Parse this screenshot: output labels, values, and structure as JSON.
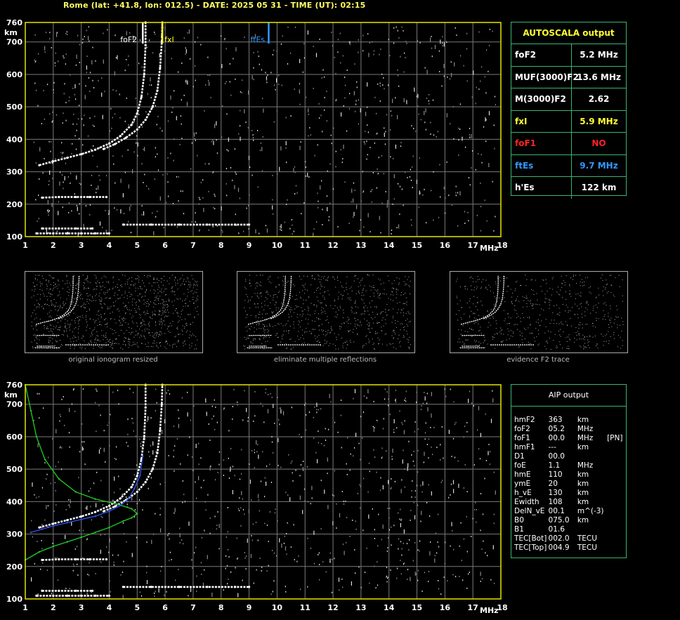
{
  "header": {
    "title": "Rome (lat: +41.8, lon: 012.5) - DATE: 2025 05 31 - TIME (UT): 02:15"
  },
  "colors": {
    "frame": "#e6e600",
    "grid": "#7a7a7a",
    "panel_border": "#3cb371",
    "trace": "#ffffff",
    "fxl": "#ffff33",
    "ftes": "#3399ff",
    "no": "#ff2222",
    "profile": "#22cc22",
    "fit": "#3355ff"
  },
  "autoscala": {
    "title": "AUTOSCALA output",
    "rows": [
      {
        "label": "foF2",
        "value": "5.2 MHz",
        "color": "#ffffff"
      },
      {
        "label": "MUF(3000)F2",
        "value": "13.6 MHz",
        "color": "#ffffff"
      },
      {
        "label": "M(3000)F2",
        "value": "2.62",
        "color": "#ffffff"
      },
      {
        "label": "fxI",
        "value": "5.9 MHz",
        "color": "#ffff33"
      },
      {
        "label": "foF1",
        "value": "NO",
        "color": "#ff2222"
      },
      {
        "label": "ftEs",
        "value": "9.7 MHz",
        "color": "#3399ff"
      },
      {
        "label": "h'Es",
        "value": "122    km",
        "color": "#ffffff"
      }
    ]
  },
  "aip": {
    "title": "AIP output",
    "rows": [
      [
        "hmF2",
        "363",
        "km",
        ""
      ],
      [
        "foF2",
        "05.2",
        "MHz",
        ""
      ],
      [
        "foF1",
        "00.0",
        "MHz",
        "[PN]"
      ],
      [
        "hmF1",
        "---",
        "km",
        ""
      ],
      [
        "D1",
        "00.0",
        "",
        ""
      ],
      [
        "foE",
        "1.1",
        "MHz",
        ""
      ],
      [
        "hmE",
        "110",
        "km",
        ""
      ],
      [
        "ymE",
        "20",
        "km",
        ""
      ],
      [
        "h_vE",
        "130",
        "km",
        ""
      ],
      [
        "Ewidth",
        "108",
        "km",
        ""
      ],
      [
        "DelN_vE",
        "00.1",
        "m^(-3)",
        ""
      ],
      [
        "B0",
        "075.0",
        "km",
        ""
      ],
      [
        "B1",
        "01.6",
        "",
        ""
      ],
      [
        "TEC[Bot]",
        "002.0",
        "TECU",
        ""
      ],
      [
        "TEC[Top]",
        "004.9",
        "TECU",
        ""
      ]
    ]
  },
  "thumbnails": [
    {
      "caption": "original ionogram resized"
    },
    {
      "caption": "eliminate multiple reflections"
    },
    {
      "caption": "evidence F2 trace"
    }
  ],
  "chart_data": [
    {
      "type": "scatter",
      "title": "",
      "xlabel": "MHz",
      "ylabel": "km",
      "xlim": [
        1,
        18
      ],
      "ylim": [
        100,
        760
      ],
      "xticks": [
        1,
        2,
        3,
        4,
        5,
        6,
        7,
        8,
        9,
        10,
        11,
        12,
        13,
        14,
        15,
        16,
        17,
        18
      ],
      "yticks": [
        100,
        200,
        300,
        400,
        500,
        600,
        700,
        760
      ],
      "grid": true,
      "markers": [
        {
          "name": "foF2",
          "x": 5.2,
          "color": "#ffffff"
        },
        {
          "name": "fxI",
          "x": 5.9,
          "color": "#ffff33"
        },
        {
          "name": "ftEs",
          "x": 9.7,
          "color": "#3399ff"
        }
      ],
      "series": [
        {
          "values": [
            [
              1.4,
              110
            ],
            [
              2.0,
              110
            ],
            [
              2.5,
              110
            ],
            [
              3.0,
              110
            ],
            [
              3.5,
              110
            ],
            [
              4.0,
              110
            ]
          ]
        },
        {
          "values": [
            [
              1.6,
              125
            ],
            [
              2.2,
              125
            ],
            [
              2.8,
              125
            ],
            [
              3.4,
              125
            ]
          ]
        },
        {
          "values": [
            [
              1.6,
              220
            ],
            [
              2.2,
              222
            ],
            [
              2.8,
              222
            ],
            [
              3.3,
              222
            ],
            [
              3.9,
              222
            ]
          ]
        },
        {
          "values": [
            [
              4.5,
              137
            ],
            [
              5.5,
              137
            ],
            [
              6.5,
              137
            ],
            [
              7.5,
              137
            ],
            [
              8.5,
              137
            ],
            [
              9.0,
              137
            ]
          ]
        },
        {
          "values": [
            [
              1.5,
              320
            ],
            [
              2.0,
              332
            ],
            [
              2.5,
              343
            ],
            [
              3.0,
              354
            ],
            [
              3.5,
              368
            ],
            [
              4.0,
              387
            ],
            [
              4.4,
              410
            ],
            [
              4.8,
              445
            ],
            [
              5.0,
              480
            ],
            [
              5.15,
              530
            ],
            [
              5.25,
              600
            ],
            [
              5.3,
              690
            ],
            [
              5.3,
              760
            ]
          ]
        },
        {
          "values": [
            [
              3.8,
              370
            ],
            [
              4.2,
              385
            ],
            [
              4.6,
              405
            ],
            [
              5.0,
              430
            ],
            [
              5.3,
              460
            ],
            [
              5.55,
              500
            ],
            [
              5.72,
              550
            ],
            [
              5.82,
              620
            ],
            [
              5.88,
              700
            ],
            [
              5.9,
              760
            ]
          ]
        }
      ]
    },
    {
      "type": "scatter",
      "title": "",
      "xlabel": "MHz",
      "ylabel": "km",
      "xlim": [
        1,
        18
      ],
      "ylim": [
        100,
        760
      ],
      "xticks": [
        1,
        2,
        3,
        4,
        5,
        6,
        7,
        8,
        9,
        10,
        11,
        12,
        13,
        14,
        15,
        16,
        17,
        18
      ],
      "yticks": [
        100,
        200,
        300,
        400,
        500,
        600,
        700,
        760
      ],
      "grid": true,
      "series": [
        {
          "values": [
            [
              1.4,
              110
            ],
            [
              2.0,
              110
            ],
            [
              2.5,
              110
            ],
            [
              3.0,
              110
            ],
            [
              3.5,
              110
            ],
            [
              4.0,
              110
            ]
          ]
        },
        {
          "values": [
            [
              1.6,
              125
            ],
            [
              2.2,
              125
            ],
            [
              2.8,
              125
            ],
            [
              3.4,
              125
            ]
          ]
        },
        {
          "values": [
            [
              1.6,
              220
            ],
            [
              2.2,
              222
            ],
            [
              2.8,
              222
            ],
            [
              3.3,
              222
            ],
            [
              3.9,
              222
            ]
          ]
        },
        {
          "values": [
            [
              4.5,
              137
            ],
            [
              5.5,
              137
            ],
            [
              6.5,
              137
            ],
            [
              7.5,
              137
            ],
            [
              8.5,
              137
            ],
            [
              9.0,
              137
            ]
          ]
        },
        {
          "values": [
            [
              1.5,
              320
            ],
            [
              2.0,
              332
            ],
            [
              2.5,
              343
            ],
            [
              3.0,
              354
            ],
            [
              3.5,
              368
            ],
            [
              4.0,
              387
            ],
            [
              4.4,
              410
            ],
            [
              4.8,
              445
            ],
            [
              5.0,
              480
            ],
            [
              5.15,
              530
            ],
            [
              5.25,
              600
            ],
            [
              5.3,
              690
            ],
            [
              5.3,
              760
            ]
          ]
        },
        {
          "values": [
            [
              3.8,
              370
            ],
            [
              4.2,
              385
            ],
            [
              4.6,
              405
            ],
            [
              5.0,
              430
            ],
            [
              5.3,
              460
            ],
            [
              5.55,
              500
            ],
            [
              5.72,
              550
            ],
            [
              5.82,
              620
            ],
            [
              5.88,
              700
            ],
            [
              5.9,
              760
            ]
          ]
        },
        {
          "name": "profile",
          "color": "#22cc22",
          "values": [
            [
              1.0,
              220
            ],
            [
              1.5,
              245
            ],
            [
              2.0,
              262
            ],
            [
              2.5,
              276
            ],
            [
              3.0,
              290
            ],
            [
              3.5,
              305
            ],
            [
              4.0,
              320
            ],
            [
              4.5,
              340
            ],
            [
              4.8,
              350
            ],
            [
              5.0,
              363
            ],
            [
              4.8,
              378
            ],
            [
              4.3,
              392
            ],
            [
              3.5,
              408
            ],
            [
              2.8,
              430
            ],
            [
              2.2,
              470
            ],
            [
              1.7,
              530
            ],
            [
              1.4,
              600
            ],
            [
              1.2,
              680
            ],
            [
              1.0,
              760
            ]
          ]
        },
        {
          "name": "fit",
          "color": "#3355ff",
          "values": [
            [
              1.2,
              305
            ],
            [
              1.6,
              315
            ],
            [
              2.0,
              325
            ],
            [
              2.5,
              335
            ],
            [
              3.0,
              345
            ],
            [
              3.5,
              355
            ],
            [
              4.0,
              370
            ],
            [
              4.4,
              388
            ],
            [
              4.7,
              410
            ],
            [
              4.9,
              440
            ],
            [
              5.1,
              480
            ],
            [
              5.2,
              540
            ]
          ]
        }
      ]
    }
  ]
}
